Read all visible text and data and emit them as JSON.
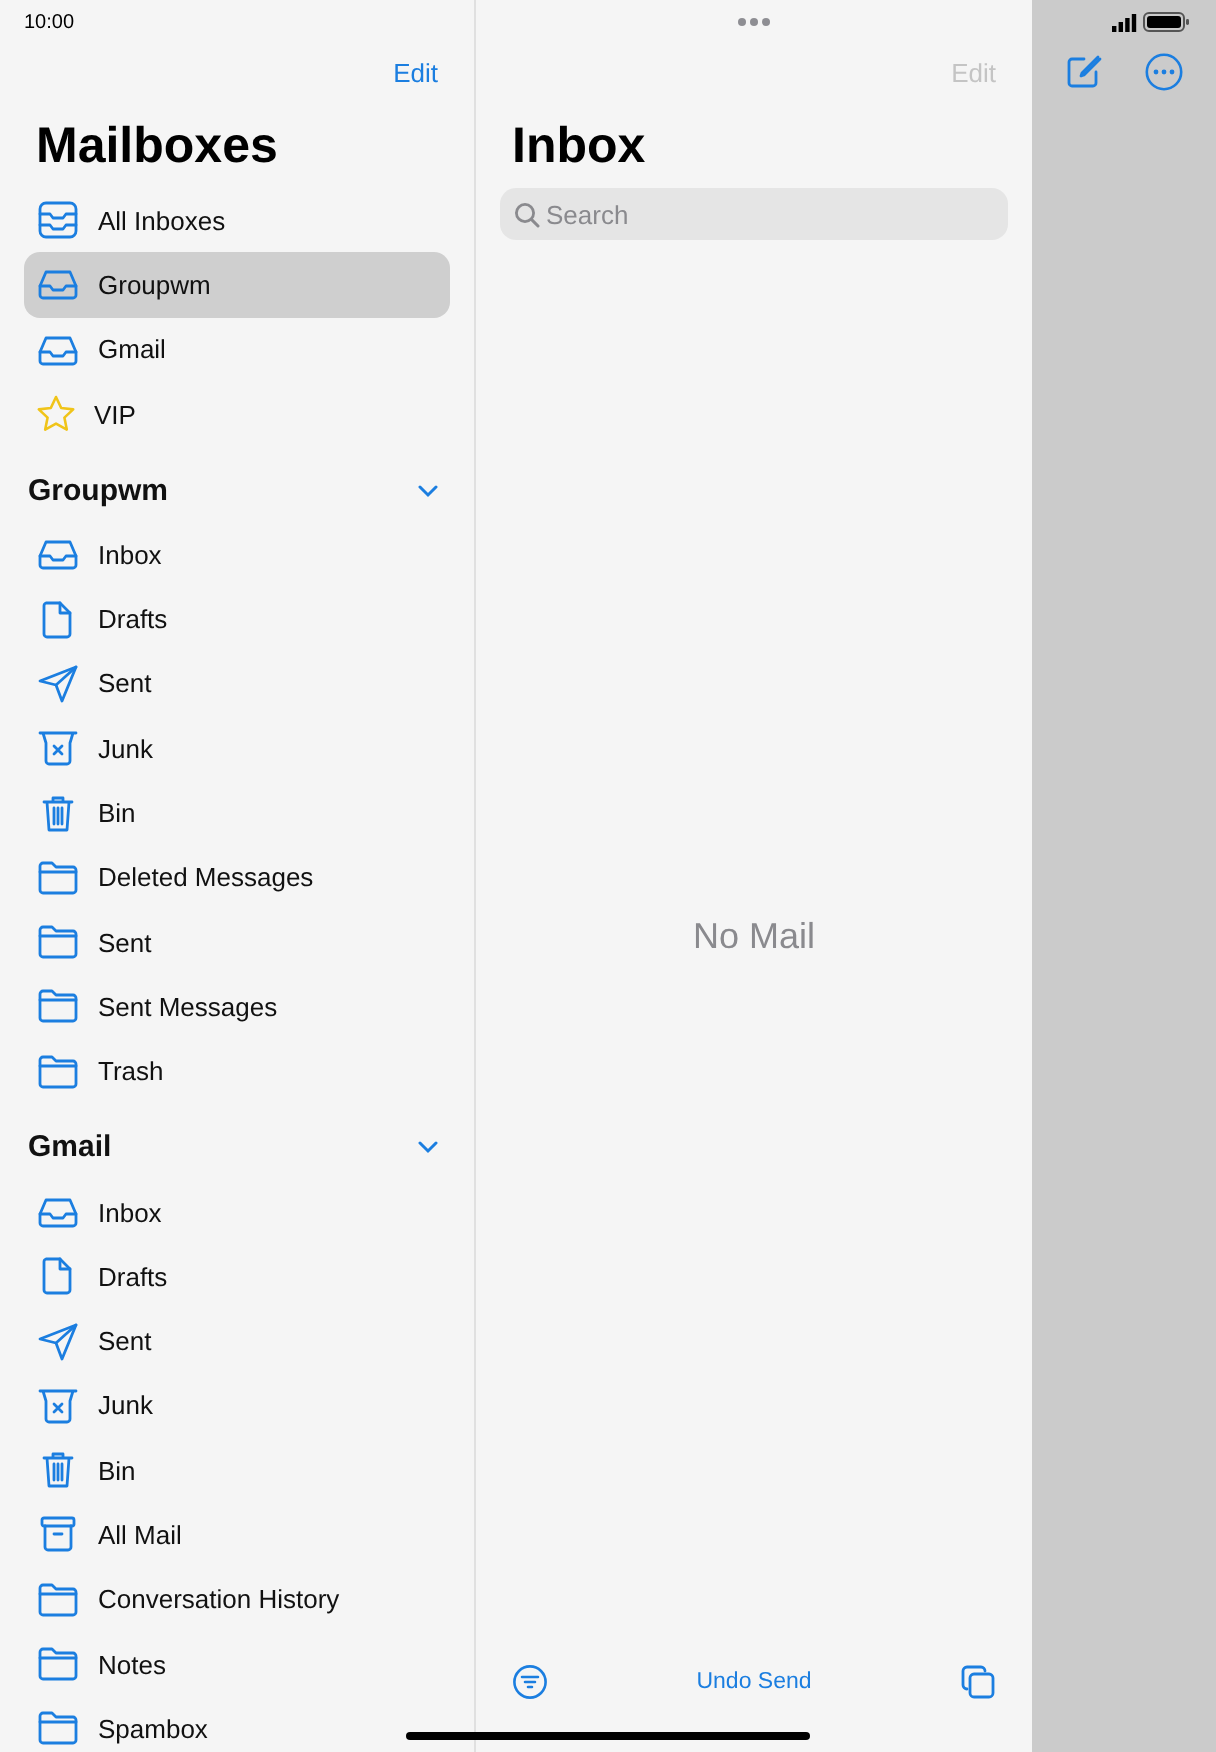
{
  "status_bar": {
    "time": "10:00"
  },
  "sidebar": {
    "edit": "Edit",
    "title": "Mailboxes",
    "favorites": [
      {
        "label": "All Inboxes",
        "kind": "allinboxes",
        "selected": false
      },
      {
        "label": "Groupwm",
        "kind": "inbox",
        "selected": true
      },
      {
        "label": "Gmail",
        "kind": "inbox",
        "selected": false
      },
      {
        "label": "VIP",
        "kind": "star",
        "selected": false
      }
    ],
    "accounts": [
      {
        "name": "Groupwm",
        "expanded": true,
        "folders": [
          {
            "label": "Inbox",
            "kind": "inbox"
          },
          {
            "label": "Drafts",
            "kind": "document"
          },
          {
            "label": "Sent",
            "kind": "send"
          },
          {
            "label": "Junk",
            "kind": "junk"
          },
          {
            "label": "Bin",
            "kind": "trash"
          },
          {
            "label": "Deleted Messages",
            "kind": "folder"
          },
          {
            "label": "Sent",
            "kind": "folder"
          },
          {
            "label": "Sent Messages",
            "kind": "folder"
          },
          {
            "label": "Trash",
            "kind": "folder"
          }
        ]
      },
      {
        "name": "Gmail",
        "expanded": true,
        "folders": [
          {
            "label": "Inbox",
            "kind": "inbox"
          },
          {
            "label": "Drafts",
            "kind": "document"
          },
          {
            "label": "Sent",
            "kind": "send"
          },
          {
            "label": "Junk",
            "kind": "junk"
          },
          {
            "label": "Bin",
            "kind": "trash"
          },
          {
            "label": "All Mail",
            "kind": "archive"
          },
          {
            "label": "Conversation History",
            "kind": "folder"
          },
          {
            "label": "Notes",
            "kind": "folder"
          },
          {
            "label": "Spambox",
            "kind": "folder"
          }
        ]
      }
    ]
  },
  "message_list": {
    "edit": "Edit",
    "edit_disabled": true,
    "title": "Inbox",
    "search": {
      "placeholder": "Search"
    },
    "empty_text": "No Mail",
    "toolbar": {
      "undo": "Undo Send"
    }
  }
}
